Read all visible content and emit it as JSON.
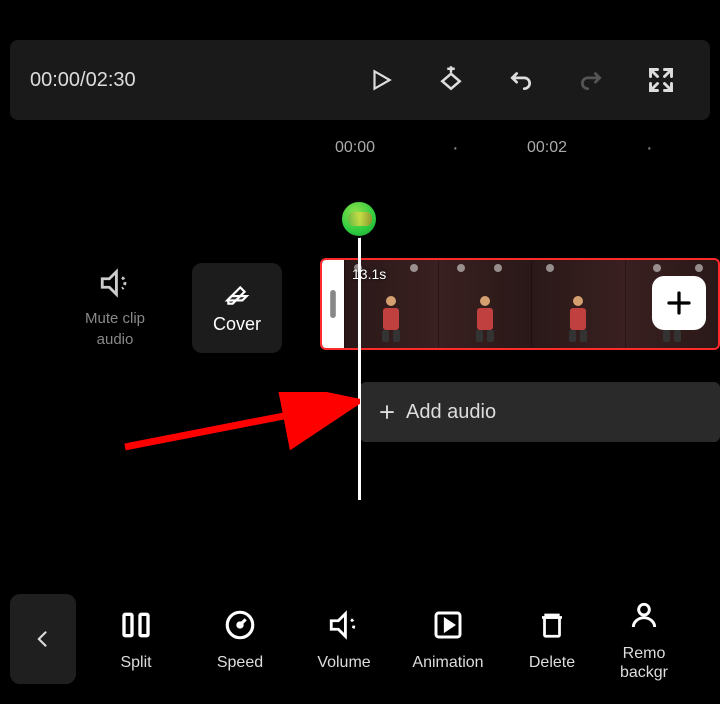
{
  "timecode": "00:00/02:30",
  "ruler": {
    "mark1": "00:00",
    "mark2": "00:02"
  },
  "mute_label_line1": "Mute clip",
  "mute_label_line2": "audio",
  "cover_label": "Cover",
  "clip_duration": "13.1s",
  "add_audio_label": "Add audio",
  "tools": {
    "split": "Split",
    "speed": "Speed",
    "volume": "Volume",
    "animation": "Animation",
    "delete": "Delete",
    "remove_bg": "Remo"
  },
  "remove_bg_line2": "backgr"
}
